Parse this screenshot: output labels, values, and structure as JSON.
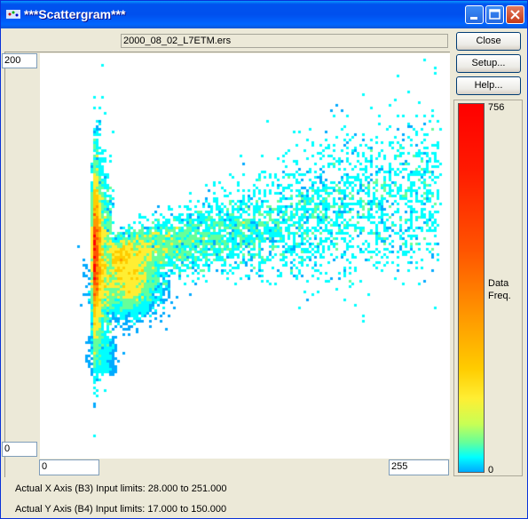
{
  "window": {
    "title": "***Scattergram***"
  },
  "file": {
    "name": "2000_08_02_L7ETM.ers"
  },
  "buttons": {
    "close": "Close",
    "setup": "Setup...",
    "help": "Help..."
  },
  "axes": {
    "y_max": "200",
    "y_min": "0",
    "x_min": "0",
    "x_max": "255"
  },
  "legend": {
    "max_value": "756",
    "min_value": "0",
    "label_line1": "Data",
    "label_line2": "Freq."
  },
  "info": {
    "x_axis": "Actual X Axis (B3) Input limits: 28.000 to 251.000",
    "y_axis": "Actual Y Axis (B4) Input limits: 17.000 to 150.000"
  },
  "chart_data": {
    "type": "heatmap",
    "xlim": [
      0,
      255
    ],
    "ylim": [
      0,
      200
    ],
    "color_scale": {
      "min": 0,
      "max": 756,
      "label": "Data Freq."
    },
    "colors": [
      "#00aaff",
      "#00ffff",
      "#66ff99",
      "#ffee33",
      "#ffcc00",
      "#ff9900",
      "#ff5500",
      "#ff0000"
    ],
    "density_peaks": [
      {
        "x": 35,
        "y": 100,
        "freq": 756
      },
      {
        "x": 55,
        "y": 85,
        "freq": 450
      }
    ]
  }
}
